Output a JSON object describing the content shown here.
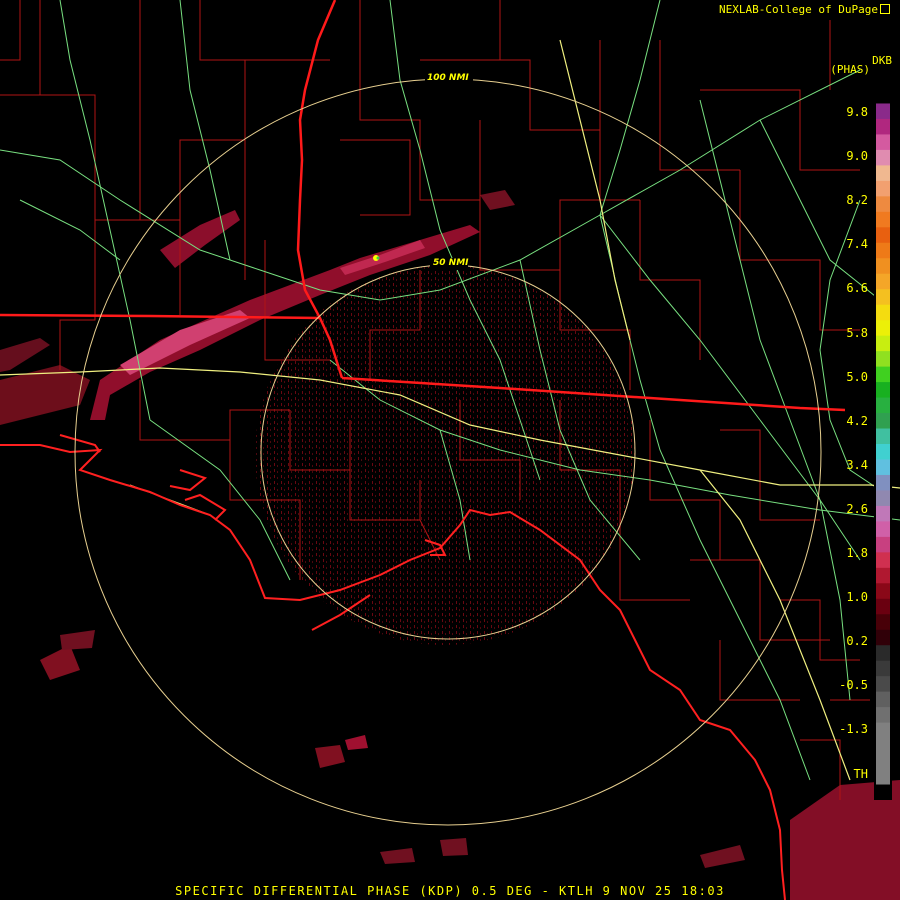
{
  "credit": "NEXLAB-College of DuPage",
  "units": {
    "line1": "DKB",
    "line2": "(PHAS)"
  },
  "ring_labels": {
    "outer": "100 NMI",
    "inner": "50 NMI"
  },
  "colorbar": {
    "ticks": [
      "9.8",
      "9.0",
      "8.2",
      "7.4",
      "6.6",
      "5.8",
      "5.0",
      "4.2",
      "3.4",
      "2.6",
      "1.8",
      "1.0",
      "0.2",
      "-0.5",
      "-1.3",
      "TH"
    ],
    "colors": [
      "#000000",
      "#8a2a8a",
      "#b0277f",
      "#d45aa0",
      "#e08cb0",
      "#f0b890",
      "#f2a070",
      "#ee8a40",
      "#f07a20",
      "#e86010",
      "#ee7a18",
      "#f09020",
      "#f4a628",
      "#f4c020",
      "#f4dc10",
      "#ecf008",
      "#c8ee10",
      "#90e020",
      "#40d020",
      "#18b020",
      "#28b040",
      "#30a050",
      "#40c0a0",
      "#40d0d0",
      "#60c0e0",
      "#8090c0",
      "#9088b0",
      "#c078b8",
      "#d060a8",
      "#c84080",
      "#d03050",
      "#b01830",
      "#8a0818",
      "#6a0010",
      "#480008",
      "#300008",
      "#2a2a2a",
      "#3a3a3a",
      "#4a4a4a",
      "#606060",
      "#707070",
      "#808080",
      "#808080",
      "#808080",
      "#808080",
      "#000000"
    ]
  },
  "title": "SPECIFIC DIFFERENTIAL PHASE (KDP) 0.5 DEG - KTLH 9 NOV 25 18:03",
  "map_colors": {
    "counties": "#b01414",
    "states": "#ff1a1a",
    "highways": "#78e080",
    "interstates": "#f0f080",
    "rings": "#e8d090",
    "coast": "#ff2020"
  },
  "icons": {
    "credit": "external-link-icon"
  }
}
